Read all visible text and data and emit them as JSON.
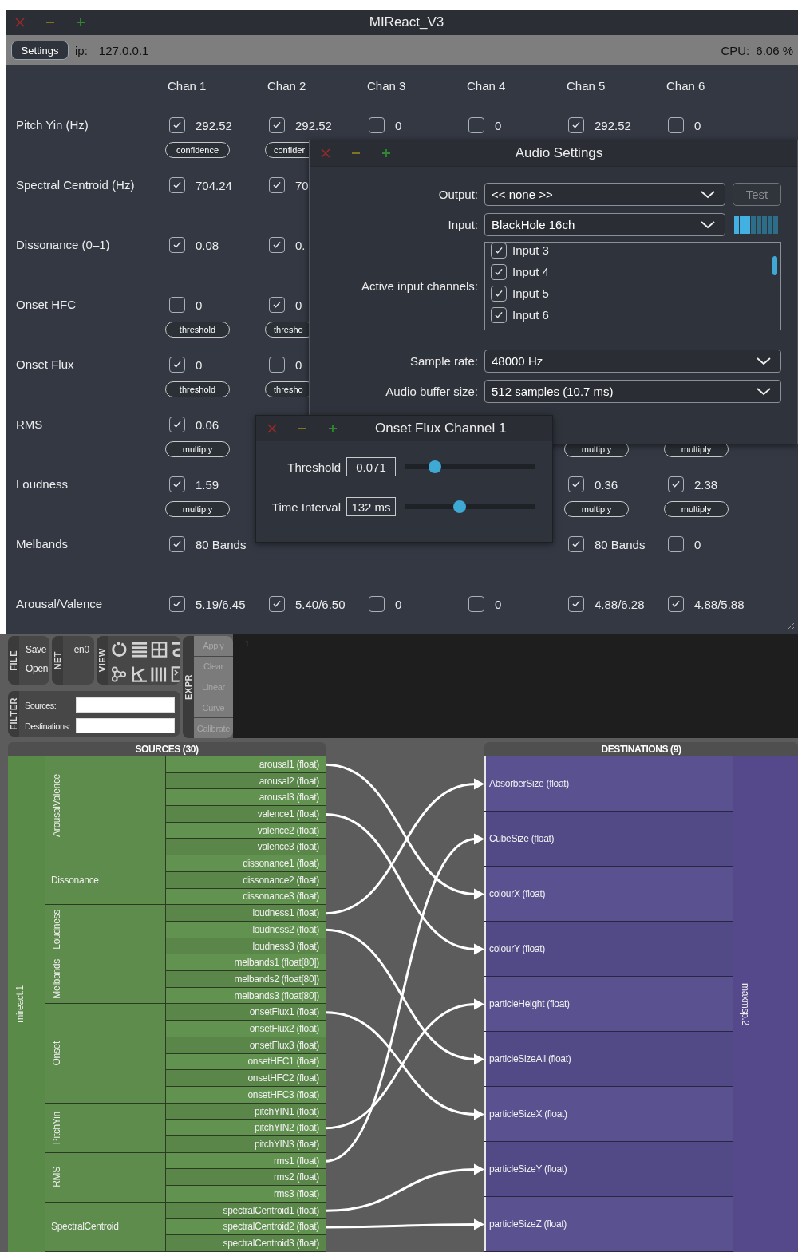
{
  "window": {
    "title": "MIReact_V3"
  },
  "toolbar": {
    "settings_button": "Settings",
    "ip_label": "ip:",
    "ip": "127.0.0.1",
    "cpu_label": "CPU:",
    "cpu": "6.06 %"
  },
  "channels": [
    "Chan 1",
    "Chan 2",
    "Chan 3",
    "Chan 4",
    "Chan 5",
    "Chan 6"
  ],
  "features": [
    {
      "label": "Pitch Yin (Hz)",
      "cells": [
        {
          "kind": "value",
          "checked": true,
          "value": "292.52",
          "button": {
            "label": "confidence",
            "clipped": false
          }
        },
        {
          "kind": "value",
          "checked": true,
          "value": "292.52",
          "button": {
            "label": "confider",
            "clipped": true
          }
        },
        {
          "kind": "value",
          "checked": false,
          "value": "0"
        },
        {
          "kind": "value",
          "checked": false,
          "value": "0"
        },
        {
          "kind": "value",
          "checked": true,
          "value": "292.52"
        },
        {
          "kind": "value",
          "checked": false,
          "value": "0"
        }
      ]
    },
    {
      "label": "Spectral Centroid (Hz)",
      "cells": [
        {
          "kind": "value",
          "checked": true,
          "value": "704.24"
        },
        {
          "kind": "value",
          "checked": true,
          "value": "70"
        }
      ]
    },
    {
      "label": "Dissonance (0–1)",
      "cells": [
        {
          "kind": "value",
          "checked": true,
          "value": "0.08"
        },
        {
          "kind": "value",
          "checked": true,
          "value": "0."
        }
      ]
    },
    {
      "label": "Onset HFC",
      "cells": [
        {
          "kind": "value",
          "checked": false,
          "value": "0",
          "button": {
            "label": "threshold",
            "clipped": false
          }
        },
        {
          "kind": "value",
          "checked": true,
          "value": "0",
          "button": {
            "label": "thresho",
            "clipped": true
          }
        }
      ]
    },
    {
      "label": "Onset Flux",
      "cells": [
        {
          "kind": "value",
          "checked": true,
          "value": "0",
          "button": {
            "label": "threshold",
            "clipped": false
          }
        },
        {
          "kind": "value",
          "checked": false,
          "value": "0",
          "button": {
            "label": "thresho",
            "clipped": true
          }
        }
      ]
    },
    {
      "label": "RMS",
      "cells": [
        {
          "kind": "value",
          "checked": true,
          "value": "0.06",
          "button": {
            "label": "multiply",
            "clipped": false
          }
        },
        {
          "kind": "blank"
        },
        {
          "kind": "blank"
        },
        {
          "kind": "blank"
        },
        {
          "kind": "blank",
          "button": {
            "label": "multiply",
            "clipped": false
          }
        },
        {
          "kind": "blank",
          "button": {
            "label": "multiply",
            "clipped": false
          }
        }
      ]
    },
    {
      "label": "Loudness",
      "cells": [
        {
          "kind": "value",
          "checked": true,
          "value": "1.59",
          "button": {
            "label": "multiply",
            "clipped": false
          }
        },
        {
          "kind": "blank"
        },
        {
          "kind": "blank"
        },
        {
          "kind": "blank"
        },
        {
          "kind": "value",
          "checked": true,
          "value": "0.36",
          "button": {
            "label": "multiply",
            "clipped": false
          }
        },
        {
          "kind": "value",
          "checked": true,
          "value": "2.38",
          "button": {
            "label": "multiply",
            "clipped": false
          }
        }
      ]
    },
    {
      "label": "Melbands",
      "cells": [
        {
          "kind": "value",
          "checked": true,
          "value": "80 Bands"
        },
        {
          "kind": "blank"
        },
        {
          "kind": "blank"
        },
        {
          "kind": "blank"
        },
        {
          "kind": "value",
          "checked": true,
          "value": "80 Bands"
        },
        {
          "kind": "value",
          "checked": false,
          "value": "0"
        }
      ]
    },
    {
      "label": "Arousal/Valence",
      "cells": [
        {
          "kind": "value",
          "checked": true,
          "value": "5.19/6.45"
        },
        {
          "kind": "value",
          "checked": true,
          "value": "5.40/6.50"
        },
        {
          "kind": "value",
          "checked": false,
          "value": "0"
        },
        {
          "kind": "value",
          "checked": false,
          "value": "0"
        },
        {
          "kind": "value",
          "checked": true,
          "value": "4.88/6.28"
        },
        {
          "kind": "value",
          "checked": true,
          "value": "4.88/5.88"
        }
      ]
    }
  ],
  "audio_settings": {
    "title": "Audio Settings",
    "output": {
      "label": "Output:",
      "value": "<< none >>"
    },
    "test_button": {
      "label": "Test",
      "disabled": true
    },
    "input": {
      "label": "Input:",
      "value": "BlackHole 16ch",
      "level": 0.375
    },
    "active_channels": {
      "label": "Active input channels:",
      "items": [
        {
          "label": "Input 3",
          "checked": true
        },
        {
          "label": "Input 4",
          "checked": true
        },
        {
          "label": "Input 5",
          "checked": true
        },
        {
          "label": "Input 6",
          "checked": true
        }
      ]
    },
    "sample_rate": {
      "label": "Sample rate:",
      "value": "48000 Hz"
    },
    "buffer_size": {
      "label": "Audio buffer size:",
      "value": "512 samples (10.7 ms)"
    }
  },
  "onset_dialog": {
    "title": "Onset Flux Channel 1",
    "params": [
      {
        "label": "Threshold",
        "value": "0.071",
        "level": 0.23
      },
      {
        "label": "Time Interval",
        "value": "132 ms",
        "level": 0.42
      }
    ]
  },
  "file_panel": {
    "title": "FILE",
    "items": [
      "Save",
      "Open"
    ]
  },
  "net_panel": {
    "title": "NET",
    "items": [
      "en0"
    ]
  },
  "view_panel": {
    "title": "VIEW"
  },
  "filter_panel": {
    "title": "FILTER",
    "fields": [
      {
        "label": "Sources:"
      },
      {
        "label": "Destinations:"
      }
    ]
  },
  "expr_panel": {
    "title": "EXPR",
    "buttons": [
      {
        "label": "Apply",
        "disabled": true
      },
      {
        "label": "Clear",
        "disabled": true
      },
      {
        "label": "Linear",
        "disabled": true
      },
      {
        "label": "Curve",
        "disabled": true
      },
      {
        "label": "Calibrate",
        "disabled": true
      }
    ]
  },
  "editor": {
    "line_numbers": [
      "1"
    ]
  },
  "sources": {
    "title": "SOURCES (30)",
    "device": "mireact.1",
    "groups": [
      {
        "name": "ArousalValence",
        "vertical": true,
        "signals": [
          {
            "label": "arousal1 (float)",
            "mapped": true
          },
          {
            "label": "arousal2 (float)",
            "mapped": false
          },
          {
            "label": "arousal3 (float)",
            "mapped": false
          },
          {
            "label": "valence1 (float)",
            "mapped": true
          },
          {
            "label": "valence2 (float)",
            "mapped": false
          },
          {
            "label": "valence3 (float)",
            "mapped": false
          }
        ]
      },
      {
        "name": "Dissonance",
        "vertical": false,
        "signals": [
          {
            "label": "dissonance1 (float)",
            "mapped": false
          },
          {
            "label": "dissonance2 (float)",
            "mapped": false
          },
          {
            "label": "dissonance3 (float)",
            "mapped": false
          }
        ]
      },
      {
        "name": "Loudness",
        "vertical": true,
        "signals": [
          {
            "label": "loudness1 (float)",
            "mapped": true
          },
          {
            "label": "loudness2 (float)",
            "mapped": true
          },
          {
            "label": "loudness3 (float)",
            "mapped": false
          }
        ]
      },
      {
        "name": "Melbands",
        "vertical": true,
        "signals": [
          {
            "label": "melbands1 (float[80])",
            "mapped": false
          },
          {
            "label": "melbands2 (float[80])",
            "mapped": false
          },
          {
            "label": "melbands3 (float[80])",
            "mapped": false
          }
        ]
      },
      {
        "name": "Onset",
        "vertical": true,
        "signals": [
          {
            "label": "onsetFlux1 (float)",
            "mapped": true
          },
          {
            "label": "onsetFlux2 (float)",
            "mapped": false
          },
          {
            "label": "onsetFlux3 (float)",
            "mapped": false
          },
          {
            "label": "onsetHFC1 (float)",
            "mapped": false
          },
          {
            "label": "onsetHFC2 (float)",
            "mapped": false
          },
          {
            "label": "onsetHFC3 (float)",
            "mapped": false
          }
        ]
      },
      {
        "name": "PitchYin",
        "vertical": true,
        "signals": [
          {
            "label": "pitchYIN1 (float)",
            "mapped": false
          },
          {
            "label": "pitchYIN2 (float)",
            "mapped": true
          },
          {
            "label": "pitchYIN3 (float)",
            "mapped": false
          }
        ]
      },
      {
        "name": "RMS",
        "vertical": true,
        "signals": [
          {
            "label": "rms1 (float)",
            "mapped": true
          },
          {
            "label": "rms2 (float)",
            "mapped": false
          },
          {
            "label": "rms3 (float)",
            "mapped": false
          }
        ]
      },
      {
        "name": "SpectralCentroid",
        "vertical": false,
        "signals": [
          {
            "label": "spectralCentroid1 (float)",
            "mapped": true
          },
          {
            "label": "spectralCentroid2 (float)",
            "mapped": true
          },
          {
            "label": "spectralCentroid3 (float)",
            "mapped": false
          }
        ]
      }
    ]
  },
  "destinations": {
    "title": "DESTINATIONS (9)",
    "device": "maxmsp.2",
    "signals": [
      {
        "label": "AbsorberSize (float)",
        "mapped": true
      },
      {
        "label": "CubeSize (float)",
        "mapped": true
      },
      {
        "label": "colourX (float)",
        "mapped": true
      },
      {
        "label": "colourY (float)",
        "mapped": true
      },
      {
        "label": "particleHeight (float)",
        "mapped": true
      },
      {
        "label": "particleSizeAll (float)",
        "mapped": true
      },
      {
        "label": "particleSizeX (float)",
        "mapped": true
      },
      {
        "label": "particleSizeY (float)",
        "mapped": true
      },
      {
        "label": "particleSizeZ (float)",
        "mapped": true
      }
    ]
  }
}
